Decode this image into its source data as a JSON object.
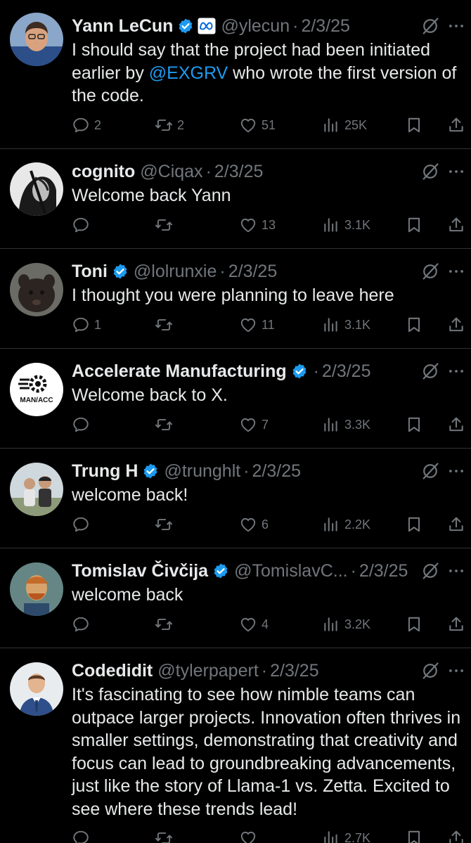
{
  "colors": {
    "background": "#000000",
    "text": "#e7e9ea",
    "muted": "#71767b",
    "link": "#1d9bf0",
    "verified": "#1d9bf0",
    "divider": "#2f3336"
  },
  "icons": {
    "reply": "reply-icon",
    "repost": "repost-icon",
    "like": "heart-icon",
    "views": "views-icon",
    "bookmark": "bookmark-icon",
    "share": "share-icon",
    "grok": "grok-icon",
    "more": "more-icon",
    "verified": "verified-badge-icon",
    "affiliate": "meta-logo-icon"
  },
  "tweets": [
    {
      "name": "Yann LeCun",
      "handle": "@ylecun",
      "date": "2/3/25",
      "sep": "·",
      "text_before": "I should say that the project had been initiated earlier by ",
      "mention": "@EXGRV",
      "text_after": " who wrote the first version of the code.",
      "replies": "2",
      "reposts": "2",
      "likes": "51",
      "views": "25K"
    },
    {
      "name": "cognito",
      "handle": "@Ciqax",
      "date": "2/3/25",
      "sep": "·",
      "text": "Welcome back Yann",
      "replies": "",
      "reposts": "",
      "likes": "13",
      "views": "3.1K"
    },
    {
      "name": "Toni",
      "handle": "@lolrunxie",
      "date": "2/3/25",
      "sep": "·",
      "text": "I thought you were planning to leave here",
      "replies": "1",
      "reposts": "",
      "likes": "11",
      "views": "3.1K"
    },
    {
      "name": "Accelerate Manufacturing",
      "handle": "",
      "date": "2/3/25",
      "sep": "·",
      "text": "Welcome back to X.",
      "avatar_text": "MAN/ACC",
      "replies": "",
      "reposts": "",
      "likes": "7",
      "views": "3.3K"
    },
    {
      "name": "Trung H",
      "handle": "@trunghlt",
      "date": "2/3/25",
      "sep": "·",
      "text": "welcome back!",
      "replies": "",
      "reposts": "",
      "likes": "6",
      "views": "2.2K"
    },
    {
      "name": "Tomislav Čivčija",
      "handle": "@TomislavC...",
      "date": "2/3/25",
      "sep": "·",
      "text": "welcome back",
      "replies": "",
      "reposts": "",
      "likes": "4",
      "views": "3.2K"
    },
    {
      "name": "Codedidit",
      "handle": "@tylerpapert",
      "date": "2/3/25",
      "sep": "·",
      "text": "It's fascinating to see how nimble teams can outpace larger projects. Innovation often thrives in smaller settings, demonstrating that creativity and focus can lead to groundbreaking advancements, just like the story of Llama-1 vs. Zetta. Excited to see where these trends lead!",
      "replies": "",
      "reposts": "",
      "likes": "",
      "views": "2.7K"
    }
  ]
}
